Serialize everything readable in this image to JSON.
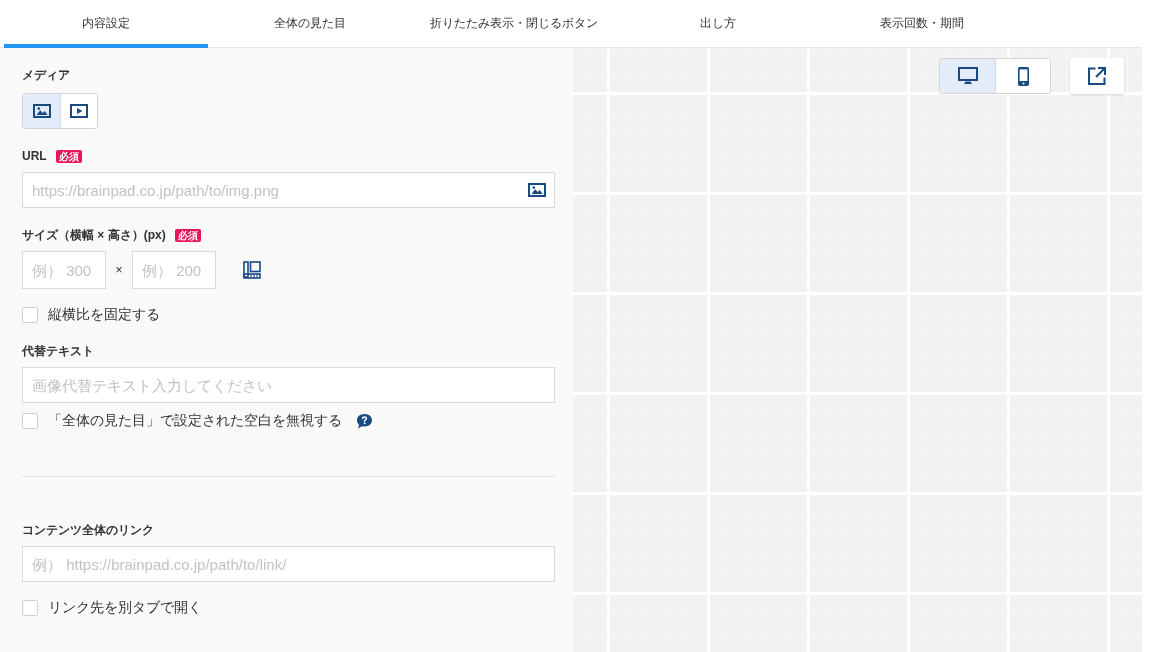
{
  "tabs": [
    {
      "label": "内容設定",
      "selected": true
    },
    {
      "label": "全体の見た目",
      "selected": false
    },
    {
      "label": "折りたたみ表示・閉じるボタン",
      "selected": false
    },
    {
      "label": "出し方",
      "selected": false
    },
    {
      "label": "表示回数・期間",
      "selected": false
    }
  ],
  "sections": [
    {
      "fields": [
        {
          "kind": "media",
          "label": "メディア",
          "options": [
            {
              "kind": "image",
              "selected": true
            },
            {
              "kind": "video",
              "selected": false
            }
          ]
        },
        {
          "kind": "text",
          "label": "URL",
          "badge": "必須",
          "placeholder": "https://brainpad.co.jp/path/to/img.png",
          "image_picker": true
        },
        {
          "kind": "size",
          "label": "サイズ（横幅 × 高さ）(px)",
          "badge": "必須",
          "width_placeholder": "例） 300",
          "separator": "×",
          "height_placeholder": "例） 200"
        },
        {
          "kind": "checkbox",
          "label": "縦横比を固定する",
          "checked": false
        },
        {
          "kind": "text",
          "label": "代替テキスト",
          "placeholder": "画像代替テキスト入力してください"
        },
        {
          "kind": "checkbox",
          "label": "「全体の見た目」で設定された空白を無視する",
          "checked": false,
          "help": true
        }
      ]
    },
    {
      "fields": [
        {
          "kind": "text",
          "label": "コンテンツ全体のリンク",
          "placeholder": "例） https://brainpad.co.jp/path/to/link/"
        },
        {
          "kind": "checkbox",
          "label": "リンク先を別タブで開く",
          "checked": false
        }
      ]
    }
  ],
  "preview": {
    "devices": [
      {
        "kind": "desktop",
        "selected": true
      },
      {
        "kind": "mobile",
        "selected": false
      }
    ]
  }
}
